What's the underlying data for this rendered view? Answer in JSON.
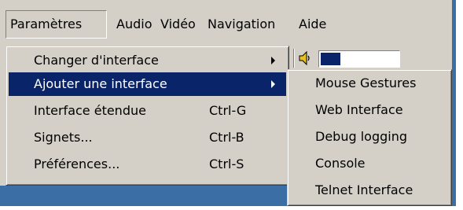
{
  "menubar": {
    "items": [
      {
        "label": "Paramètres",
        "open": true
      },
      {
        "label": "Audio"
      },
      {
        "label": "Vidéo"
      },
      {
        "label": "Navigation"
      },
      {
        "label": "Aide"
      }
    ]
  },
  "main_menu": {
    "items": [
      {
        "label": "Changer d'interface",
        "shortcut": "",
        "submenu_arrow": true
      },
      {
        "label": "Ajouter une interface",
        "shortcut": "",
        "submenu_arrow": true,
        "highlighted": true
      },
      {
        "label": "Interface étendue",
        "shortcut": "Ctrl-G"
      },
      {
        "label": "Signets...",
        "shortcut": "Ctrl-B"
      },
      {
        "label": "Préférences...",
        "shortcut": "Ctrl-S"
      }
    ]
  },
  "submenu": {
    "items": [
      {
        "label": "Mouse Gestures"
      },
      {
        "label": "Web Interface"
      },
      {
        "label": "Debug logging"
      },
      {
        "label": "Console"
      },
      {
        "label": "Telnet Interface"
      }
    ]
  },
  "toolbar": {
    "volume_icon": "speaker-icon",
    "volume_level": 0.25
  },
  "colors": {
    "menu_bg": "#d4d0c8",
    "highlight": "#0a246a",
    "highlight_text": "#ffffff",
    "desktop_blue": "#3a6ea5"
  }
}
